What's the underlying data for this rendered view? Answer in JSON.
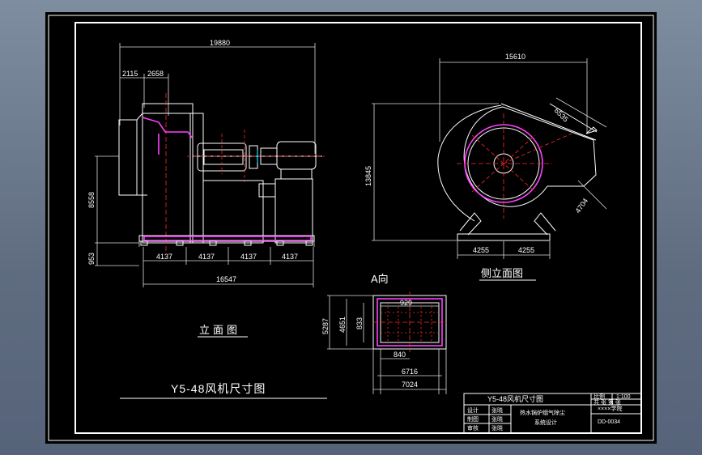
{
  "drawing": {
    "front_title": "立面图",
    "side_title": "侧立面图",
    "view_a_label": "A向",
    "main_title": "Y5-48风机尺寸图",
    "front_dims": {
      "overall_width": "19880",
      "left_offset": "2115",
      "inlet_offset": "2658",
      "height": "8558",
      "base_height": "953",
      "span_1": "4137",
      "span_2": "4137",
      "span_3": "4137",
      "span_4": "4137",
      "base_length": "16547"
    },
    "side_dims": {
      "overall_width": "15610",
      "height": "13845",
      "radius_1": "6535",
      "radius_2": "4704",
      "half_base_left": "4255",
      "half_base_right": "4255"
    },
    "view_a_dims": {
      "inner_width": "929",
      "outer_height": "5287",
      "mid_height": "4651",
      "inner_height": "833",
      "bottom_inner": "840",
      "bottom_mid": "6716",
      "bottom_outer": "7024"
    },
    "title_block": {
      "name": "Y5-48风机尺寸图",
      "scale_label": "比例",
      "scale": "1:100",
      "sheet_label": "共 张  第 张",
      "project": "热水锅炉烟气除尘",
      "project_sub": "系统设计",
      "school": "××××学院",
      "dwg_no": "DD-0034",
      "rows": [
        "设计",
        "制图",
        "审核"
      ],
      "row_values": [
        "张晓",
        "张晓",
        "张晓"
      ]
    },
    "colors": {
      "background": "#000000",
      "line": "#ffffff",
      "accent_red": "#ff2a2a",
      "accent_magenta": "#ff40ff",
      "accent_cyan": "#00e5ff"
    }
  }
}
